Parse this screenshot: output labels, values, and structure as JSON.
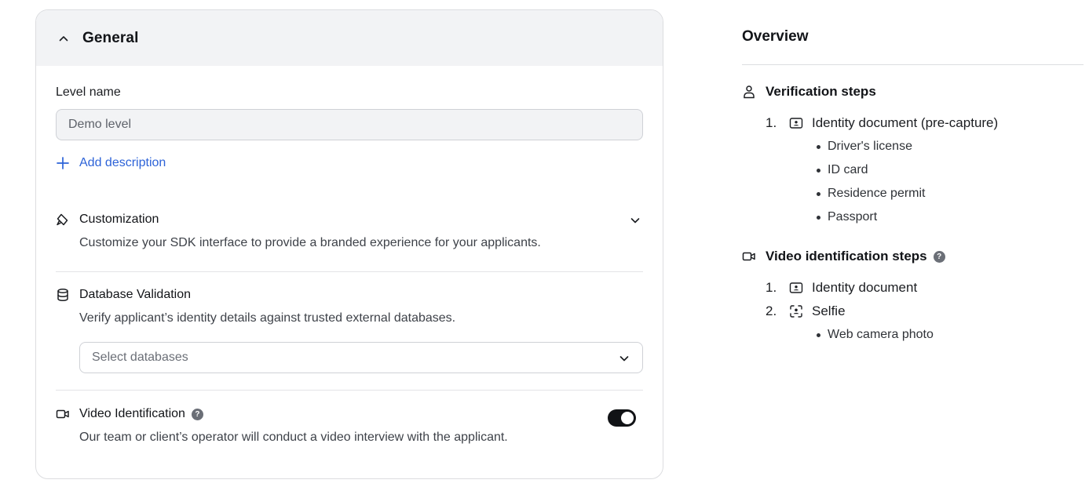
{
  "general": {
    "title": "General",
    "level_name_label": "Level name",
    "level_name_value": "Demo level",
    "add_description": "Add description",
    "customization": {
      "title": "Customization",
      "description": "Customize your SDK interface to provide a branded experience for your applicants."
    },
    "database_validation": {
      "title": "Database Validation",
      "description": "Verify applicant’s identity details against trusted external databases.",
      "select_placeholder": "Select databases"
    },
    "video_identification": {
      "title": "Video Identification",
      "description": "Our team or client’s operator will conduct a video interview with the applicant.",
      "enabled": true,
      "help": "?"
    }
  },
  "overview": {
    "title": "Overview",
    "verification_steps": {
      "title": "Verification steps",
      "steps": [
        {
          "num": "1.",
          "label": "Identity document (pre-capture)",
          "icon": "id-card-icon",
          "items": [
            "Driver's license",
            "ID card",
            "Residence permit",
            "Passport"
          ]
        }
      ]
    },
    "video_steps": {
      "title": "Video identification steps",
      "help": "?",
      "steps": [
        {
          "num": "1.",
          "label": "Identity document",
          "icon": "id-card-icon"
        },
        {
          "num": "2.",
          "label": "Selfie",
          "icon": "face-scan-icon",
          "items": [
            "Web camera photo"
          ]
        }
      ]
    }
  },
  "colors": {
    "link": "#2d63d8",
    "header_bg": "#f2f3f5",
    "toggle_on": "#111316"
  }
}
